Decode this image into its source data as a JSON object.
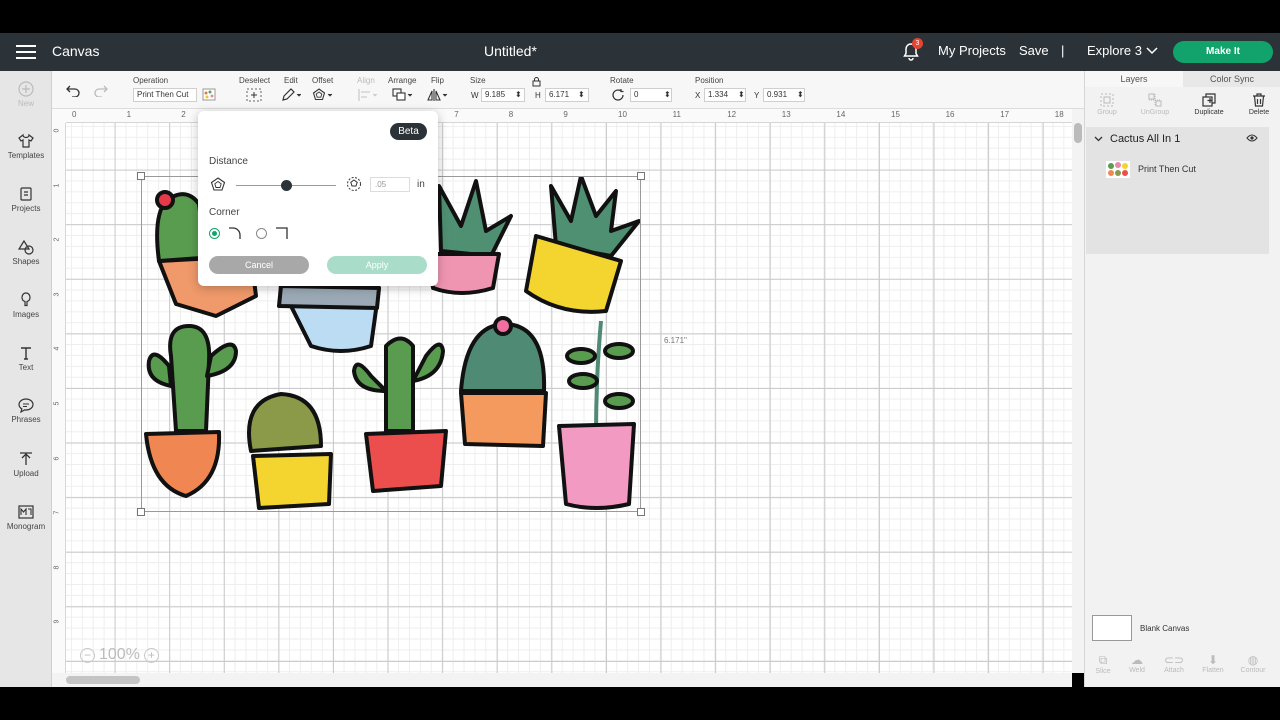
{
  "header": {
    "app_title": "Canvas",
    "doc_title": "Untitled*",
    "notification_count": "3",
    "my_projects": "My Projects",
    "save": "Save",
    "separator": "|",
    "machine": "Explore 3",
    "make_it": "Make It"
  },
  "sidebar": {
    "new_label": "New",
    "items": [
      {
        "label": "Templates",
        "icon": "shirt-icon"
      },
      {
        "label": "Projects",
        "icon": "projects-icon"
      },
      {
        "label": "Shapes",
        "icon": "shapes-icon"
      },
      {
        "label": "Images",
        "icon": "images-icon"
      },
      {
        "label": "Text",
        "icon": "text-icon"
      },
      {
        "label": "Phrases",
        "icon": "phrases-icon"
      },
      {
        "label": "Upload",
        "icon": "upload-icon"
      },
      {
        "label": "Monogram",
        "icon": "monogram-icon"
      }
    ]
  },
  "toolbar": {
    "operation_label": "Operation",
    "operation_value": "Print Then Cut",
    "deselect_label": "Deselect",
    "edit_label": "Edit",
    "offset_label": "Offset",
    "align_label": "Align",
    "arrange_label": "Arrange",
    "flip_label": "Flip",
    "size_label": "Size",
    "w_label": "W",
    "w_value": "9.185",
    "h_label": "H",
    "h_value": "6.171",
    "rotate_label": "Rotate",
    "rotate_value": "0",
    "position_label": "Position",
    "x_label": "X",
    "x_value": "1.334",
    "y_label": "Y",
    "y_value": "0.931"
  },
  "ruler": {
    "top_ticks": [
      "0",
      "1",
      "2",
      "3",
      "4",
      "5",
      "6",
      "7",
      "8",
      "9",
      "10",
      "11",
      "12",
      "13",
      "14",
      "15",
      "16",
      "17",
      "18"
    ],
    "left_ticks": [
      "0",
      "1",
      "2",
      "3",
      "4",
      "5",
      "6",
      "7",
      "8",
      "9"
    ]
  },
  "canvas": {
    "height_dimension": "6.171\"",
    "zoom": "100%"
  },
  "offset_popup": {
    "badge": "Beta",
    "distance_label": "Distance",
    "distance_value": ".05",
    "distance_unit": "in",
    "distance_level": 0.5,
    "corner_label": "Corner",
    "cancel": "Cancel",
    "apply": "Apply"
  },
  "right_panel": {
    "tabs": [
      "Layers",
      "Color Sync"
    ],
    "tools": [
      {
        "label": "Group",
        "enabled": false
      },
      {
        "label": "UnGroup",
        "enabled": false
      },
      {
        "label": "Duplicate",
        "enabled": true
      },
      {
        "label": "Delete",
        "enabled": true
      }
    ],
    "group_name": "Cactus All In 1",
    "layer_name": "Print Then Cut",
    "blank_canvas": "Blank Canvas",
    "bottom_tools": [
      "Slice",
      "Weld",
      "Attach",
      "Flatten",
      "Contour"
    ]
  },
  "colors": {
    "header_bg": "#2c3338",
    "accent_green": "#11a36b",
    "badge_red": "#e8432f"
  }
}
